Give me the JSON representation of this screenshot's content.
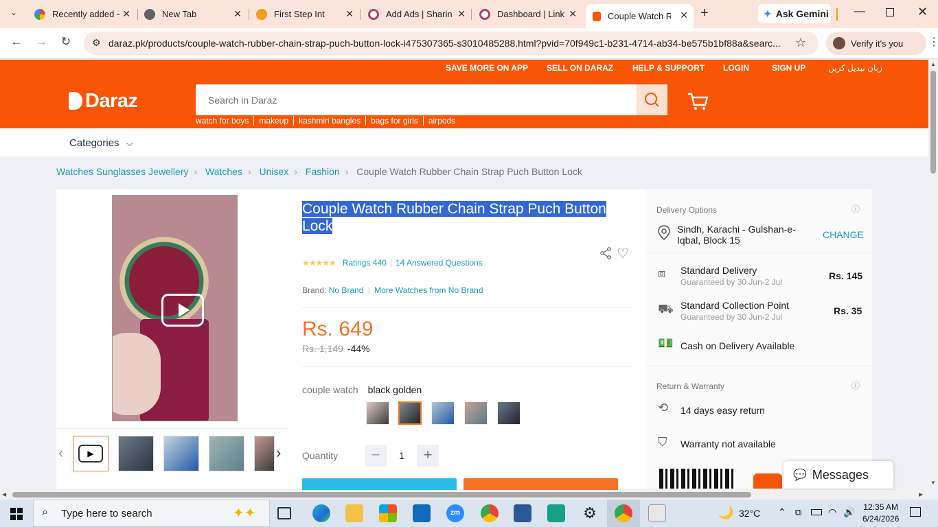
{
  "browser": {
    "tabs": [
      {
        "title": "Recently added -",
        "active": false
      },
      {
        "title": "New Tab",
        "active": false
      },
      {
        "title": "First Step Int",
        "active": false
      },
      {
        "title": "Add Ads | Sharin",
        "active": false
      },
      {
        "title": "Dashboard | Link",
        "active": false
      },
      {
        "title": "Couple Watch Ru",
        "active": true
      }
    ],
    "ask_gemini": "Ask Gemini",
    "url": "daraz.pk/products/couple-watch-rubber-chain-strap-puch-button-lock-i475307365-s3010485288.html?pvid=70f949c1-b231-4714-ab34-be575b1bf88a&searc...",
    "verify": "Verify it's you"
  },
  "header": {
    "top_links": [
      "SAVE MORE ON APP",
      "SELL ON DARAZ",
      "HELP & SUPPORT",
      "LOGIN",
      "SIGN UP",
      "زبان تبدیل کریں"
    ],
    "logo": "Daraz",
    "search_placeholder": "Search in Daraz",
    "hotwords": [
      "watch for boys",
      "makeup",
      "kashmiri bangles",
      "bags for girls",
      "airpods"
    ],
    "categories": "Categories"
  },
  "breadcrumb": {
    "links": [
      "Watches Sunglasses Jewellery",
      "Watches",
      "Unisex",
      "Fashion"
    ],
    "current": "Couple Watch Rubber Chain Strap Puch Button Lock"
  },
  "product": {
    "title": "Couple Watch Rubber Chain Strap Puch Button Lock",
    "rating_stars": 4.5,
    "ratings": "Ratings 440",
    "answered": "14 Answered Questions",
    "brand_label": "Brand:",
    "brand": "No Brand",
    "more_from": "More Watches from No Brand",
    "price": "Rs. 649",
    "old_price": "Rs. 1,149",
    "discount": "-44%",
    "color_family_label": "couple watch",
    "color_family_value": "black golden",
    "quantity_label": "Quantity",
    "quantity": "1"
  },
  "delivery": {
    "heading": "Delivery Options",
    "location": "Sindh, Karachi - Gulshan-e-Iqbal, Block 15",
    "change": "CHANGE",
    "options": [
      {
        "title": "Standard Delivery",
        "sub": "Guaranteed by 30 Jun-2 Jul",
        "price": "Rs. 145"
      },
      {
        "title": "Standard Collection Point",
        "sub": "Guaranteed by 30 Jun-2 Jul",
        "price": "Rs. 35"
      }
    ],
    "cod": "Cash on Delivery Available",
    "warranty_heading": "Return & Warranty",
    "return": "14 days easy return",
    "warranty": "Warranty not available"
  },
  "messages": "Messages",
  "taskbar": {
    "search": "Type here to search",
    "temperature": "32°C",
    "time": "12:35 AM",
    "date": "6/24/2026"
  },
  "colors": {
    "daraz_orange": "#f85606",
    "link_blue": "#1a9cb7",
    "price_orange": "#f57224",
    "selection_blue": "#3367d6"
  }
}
